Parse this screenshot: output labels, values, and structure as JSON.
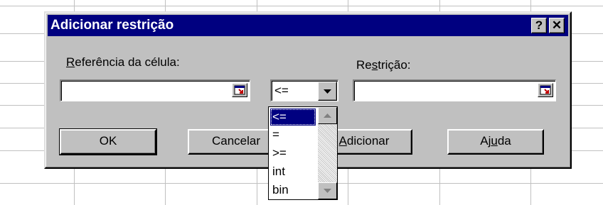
{
  "dialog": {
    "title": "Adicionar restrição",
    "help_button": "?",
    "close_button": "✕"
  },
  "cell_reference": {
    "label_underlined": "R",
    "label_rest": "eferência da célula:",
    "value": ""
  },
  "operator": {
    "selected": "<=",
    "options": [
      "<=",
      "=",
      ">=",
      "int",
      "bin"
    ]
  },
  "constraint": {
    "label_pre": "Re",
    "label_underlined": "s",
    "label_post": "trição:",
    "value": ""
  },
  "buttons": {
    "ok": "OK",
    "cancel": "Cancelar",
    "add_underlined": "A",
    "add_rest": "dicionar",
    "help_pre": "Aj",
    "help_underlined": "u",
    "help_post": "da"
  }
}
